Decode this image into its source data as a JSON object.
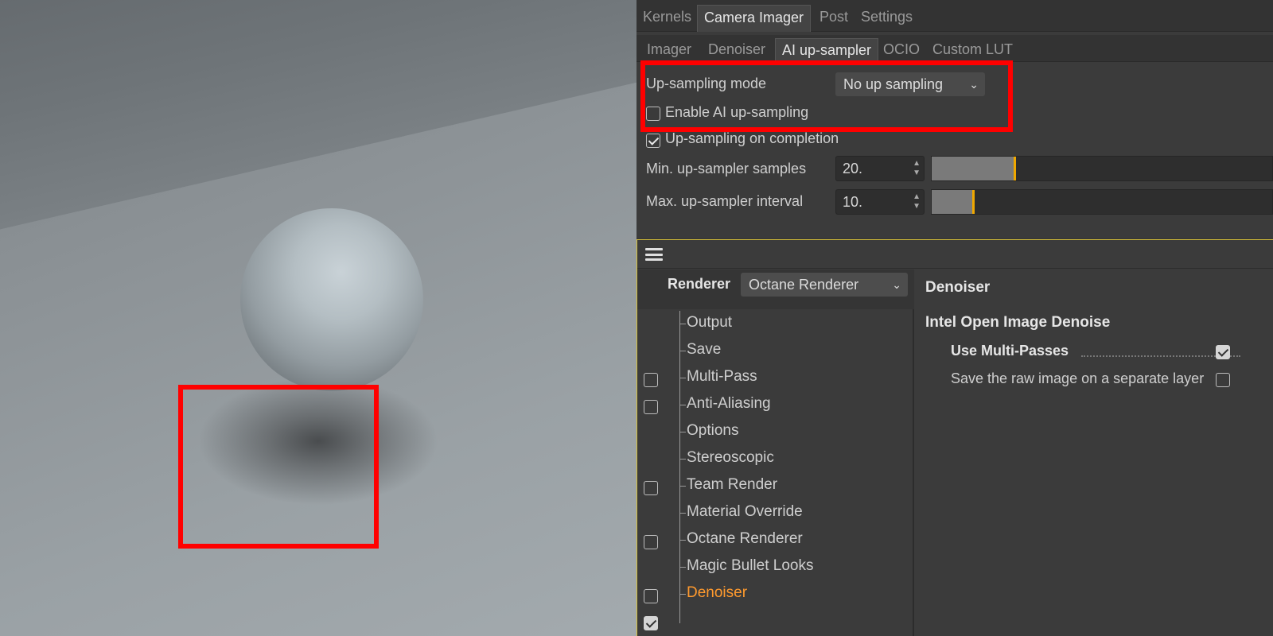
{
  "camera_imager": {
    "main_tabs": [
      "Kernels",
      "Camera Imager",
      "Post",
      "Settings"
    ],
    "active_main_tab": "Camera Imager",
    "sub_tabs": [
      "Imager",
      "Denoiser",
      "AI up-sampler",
      "OCIO",
      "Custom LUT"
    ],
    "active_sub_tab": "AI up-sampler",
    "up_sampling_mode_label": "Up-sampling mode",
    "up_sampling_mode_value": "No up sampling",
    "enable_ai_label": "Enable AI up-sampling",
    "enable_ai_checked": false,
    "on_completion_label": "Up-sampling on completion",
    "on_completion_checked": true,
    "min_samples_label": "Min. up-sampler samples",
    "min_samples_value": "20.",
    "max_interval_label": "Max. up-sampler interval",
    "max_interval_value": "10."
  },
  "render_settings": {
    "renderer_label": "Renderer",
    "renderer_value": "Octane Renderer",
    "tree_items": [
      {
        "label": "Output",
        "has_checkbox": false,
        "checked": false
      },
      {
        "label": "Save",
        "has_checkbox": true,
        "checked": false
      },
      {
        "label": "Multi-Pass",
        "has_checkbox": true,
        "checked": false
      },
      {
        "label": "Anti-Aliasing",
        "has_checkbox": false,
        "checked": false
      },
      {
        "label": "Options",
        "has_checkbox": false,
        "checked": false
      },
      {
        "label": "Stereoscopic",
        "has_checkbox": true,
        "checked": false
      },
      {
        "label": "Team Render",
        "has_checkbox": false,
        "checked": false
      },
      {
        "label": "Material Override",
        "has_checkbox": true,
        "checked": false
      },
      {
        "label": "Octane Renderer",
        "has_checkbox": false,
        "checked": false
      },
      {
        "label": "Magic Bullet Looks",
        "has_checkbox": true,
        "checked": false
      },
      {
        "label": "Denoiser",
        "has_checkbox": true,
        "checked": true,
        "active": true
      }
    ],
    "detail": {
      "title": "Denoiser",
      "section": "Intel Open Image Denoise",
      "use_multi_passes_label": "Use Multi-Passes",
      "use_multi_passes_checked": true,
      "save_raw_label": "Save the raw image on a separate layer",
      "save_raw_checked": false
    }
  },
  "colors": {
    "highlight": "#ff0000",
    "active_item": "#ff9a2e",
    "slider_marker": "#f0a800"
  },
  "icons": [
    "chevron-down-icon",
    "spin-arrows-icon",
    "hamburger-menu-icon",
    "checkmark-icon"
  ]
}
